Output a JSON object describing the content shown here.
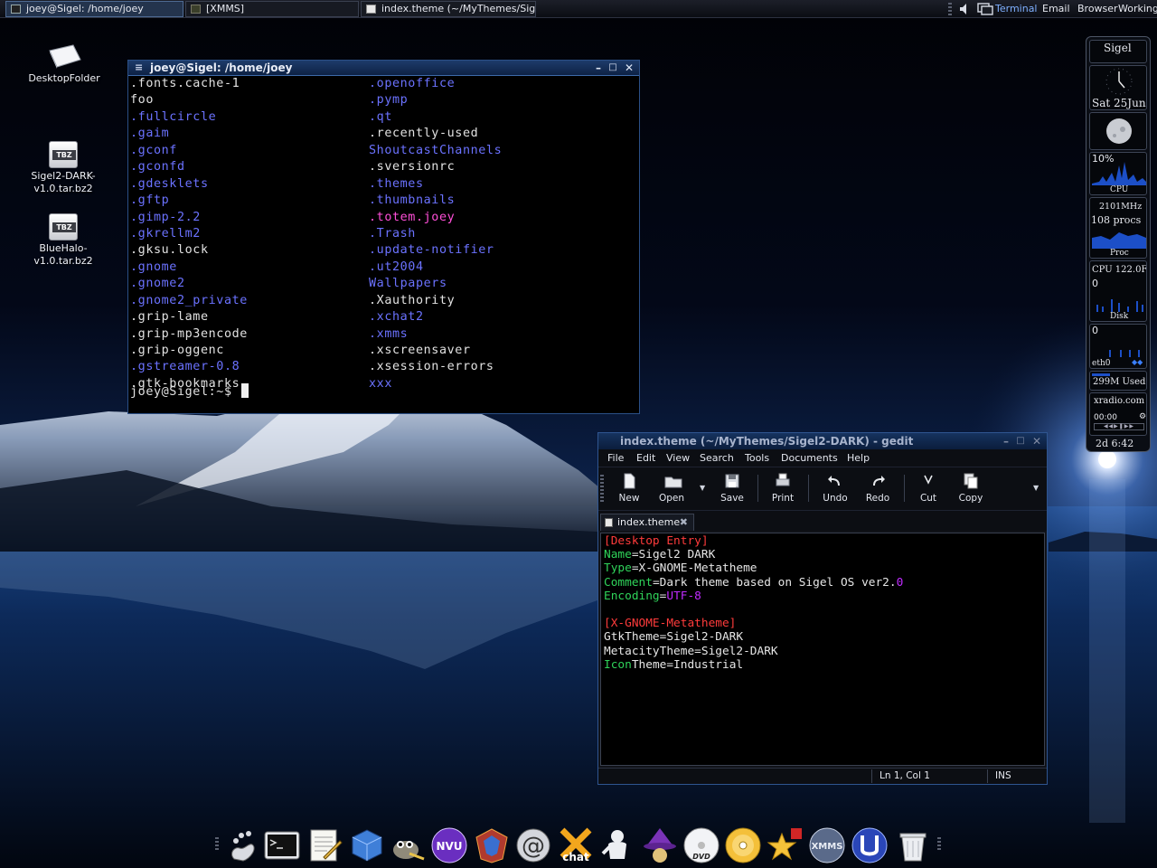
{
  "top_panel": {
    "tasks": [
      {
        "label": "joey@Sigel: /home/joey",
        "active": true
      },
      {
        "label": "[XMMS]",
        "active": false
      },
      {
        "label": "index.theme (~/MyThemes/Sig...",
        "active": false
      }
    ],
    "launchers": [
      {
        "label": "Terminal",
        "highlight": true
      },
      {
        "label": "Email",
        "highlight": false
      },
      {
        "label": "Browser",
        "highlight": false
      },
      {
        "label": "Working",
        "highlight": false
      }
    ]
  },
  "desktop_icons": [
    {
      "name": "desktop-folder",
      "label_lines": [
        "DesktopFolder"
      ]
    },
    {
      "name": "sigel2-dark-archive",
      "badge": "TBZ",
      "label_lines": [
        "Sigel2-DARK-",
        "v1.0.tar.bz2"
      ]
    },
    {
      "name": "bluehalo-archive",
      "badge": "TBZ",
      "label_lines": [
        "BlueHalo-",
        "v1.0.tar.bz2"
      ]
    }
  ],
  "terminal": {
    "title": "joey@Sigel: /home/joey",
    "col1": [
      {
        "text": ".fonts.cache-1",
        "color": "white"
      },
      {
        "text": "foo",
        "color": "white"
      },
      {
        "text": ".fullcircle",
        "color": "blue"
      },
      {
        "text": ".gaim",
        "color": "blue"
      },
      {
        "text": ".gconf",
        "color": "blue"
      },
      {
        "text": ".gconfd",
        "color": "blue"
      },
      {
        "text": ".gdesklets",
        "color": "blue"
      },
      {
        "text": ".gftp",
        "color": "blue"
      },
      {
        "text": ".gimp-2.2",
        "color": "blue"
      },
      {
        "text": ".gkrellm2",
        "color": "blue"
      },
      {
        "text": ".gksu.lock",
        "color": "white"
      },
      {
        "text": ".gnome",
        "color": "blue"
      },
      {
        "text": ".gnome2",
        "color": "blue"
      },
      {
        "text": ".gnome2_private",
        "color": "blue"
      },
      {
        "text": ".grip-lame",
        "color": "white"
      },
      {
        "text": ".grip-mp3encode",
        "color": "white"
      },
      {
        "text": ".grip-oggenc",
        "color": "white"
      },
      {
        "text": ".gstreamer-0.8",
        "color": "blue"
      },
      {
        "text": ".gtk-bookmarks",
        "color": "white"
      }
    ],
    "col2": [
      {
        "text": ".openoffice",
        "color": "blue"
      },
      {
        "text": ".pymp",
        "color": "blue"
      },
      {
        "text": ".qt",
        "color": "blue"
      },
      {
        "text": ".recently-used",
        "color": "white"
      },
      {
        "text": "ShoutcastChannels",
        "color": "blue"
      },
      {
        "text": ".sversionrc",
        "color": "white"
      },
      {
        "text": ".themes",
        "color": "blue"
      },
      {
        "text": ".thumbnails",
        "color": "blue"
      },
      {
        "text": ".totem.joey",
        "color": "magenta"
      },
      {
        "text": ".Trash",
        "color": "blue"
      },
      {
        "text": ".update-notifier",
        "color": "blue"
      },
      {
        "text": ".ut2004",
        "color": "blue"
      },
      {
        "text": "Wallpapers",
        "color": "blue"
      },
      {
        "text": ".Xauthority",
        "color": "white"
      },
      {
        "text": ".xchat2",
        "color": "blue"
      },
      {
        "text": ".xmms",
        "color": "blue"
      },
      {
        "text": ".xscreensaver",
        "color": "white"
      },
      {
        "text": ".xsession-errors",
        "color": "white"
      },
      {
        "text": "xxx",
        "color": "blue"
      }
    ],
    "prompt": "joey@Sigel:~$ "
  },
  "gedit": {
    "title": "index.theme (~/MyThemes/Sigel2-DARK) - gedit",
    "menus": [
      "File",
      "Edit",
      "View",
      "Search",
      "Tools",
      "Documents",
      "Help"
    ],
    "toolbar": [
      "New",
      "Open",
      "Save",
      "Print",
      "Undo",
      "Redo",
      "Cut",
      "Copy"
    ],
    "tab_label": "index.theme",
    "lines": [
      [
        {
          "t": "[Desktop Entry]",
          "c": "sec"
        }
      ],
      [
        {
          "t": "Name",
          "c": "key"
        },
        {
          "t": "=Sigel2 DARK",
          "c": "val"
        }
      ],
      [
        {
          "t": "Type",
          "c": "key"
        },
        {
          "t": "=X-GNOME-Metatheme",
          "c": "val"
        }
      ],
      [
        {
          "t": "Comment",
          "c": "key"
        },
        {
          "t": "=Dark theme based on Sigel OS ver2.",
          "c": "val"
        },
        {
          "t": "0",
          "c": "num"
        }
      ],
      [
        {
          "t": "Encoding",
          "c": "key"
        },
        {
          "t": "=",
          "c": "val"
        },
        {
          "t": "UTF-8",
          "c": "num"
        }
      ],
      [],
      [
        {
          "t": "[X-GNOME-Metatheme]",
          "c": "sec"
        }
      ],
      [
        {
          "t": "GtkTheme=Sigel2-DARK",
          "c": "val"
        }
      ],
      [
        {
          "t": "MetacityTheme=Sigel2-DARK",
          "c": "val"
        }
      ],
      [
        {
          "t": "Icon",
          "c": "key"
        },
        {
          "t": "Theme=Industrial",
          "c": "val"
        }
      ]
    ],
    "status": {
      "position": "Ln 1, Col 1",
      "mode": "INS"
    }
  },
  "sidebar": {
    "host": "Sigel",
    "date": "Sat 25Jun",
    "cpu_percent": "10%",
    "cpu_label": "CPU",
    "cpu_freq": "2101MHz",
    "procs": "108 procs",
    "proc_label": "Proc",
    "cpu_temp": "CPU 122.0F",
    "disk_value": "0",
    "disk_label": "Disk",
    "net_value": "0",
    "net_label": "eth0",
    "mem": "299M Used",
    "radio": "xradio.com",
    "radio_time": "00:00",
    "uptime": "2d  6:42"
  },
  "dock": {
    "items": [
      "gnome-foot-icon",
      "terminal-icon",
      "text-editor-icon",
      "file-manager-icon",
      "gimp-icon",
      "nvu-icon",
      "unreal-icon",
      "email-icon",
      "xchat-icon",
      "gaim-icon",
      "wizard-icon",
      "dvd-icon",
      "cd-player-icon",
      "shiny-star-icon",
      "xmms-icon",
      "unreal-tournament-icon",
      "trash-icon"
    ],
    "labels": {
      "nvu": "NVU",
      "chat": "chat",
      "xmms": "XMMS",
      "dvd": "DVD"
    }
  },
  "colors": {
    "accent": "#2f5590",
    "term_blue": "#6b72ff",
    "term_magenta": "#ff4fd8",
    "key_green": "#2fd35a",
    "section_red": "#ff3b3b"
  }
}
